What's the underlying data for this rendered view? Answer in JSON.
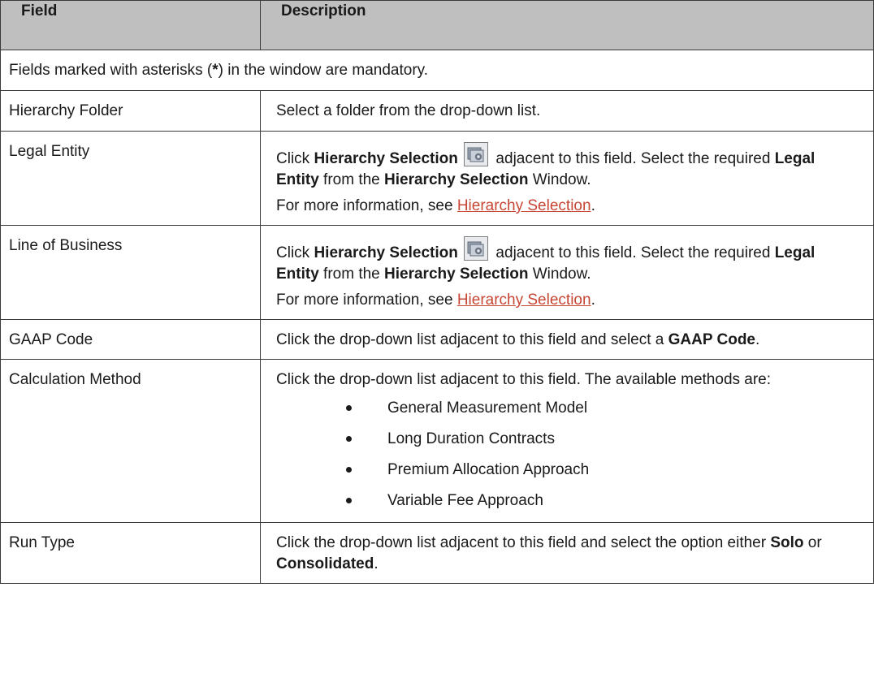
{
  "header": {
    "field": "Field",
    "description": "Description"
  },
  "note": {
    "before": "Fields marked with asterisks (",
    "star": "*",
    "after": ") in the window are mandatory."
  },
  "rows": [
    {
      "field": "Hierarchy Folder",
      "text": "Select a folder from the drop-down list."
    },
    {
      "field": "Legal Entity",
      "click": "Click ",
      "bold1": "Hierarchy Selection",
      "icon": "hierarchy-selection-icon",
      "t2": " adjacent to this field. Select the required ",
      "bold2": "Legal Entity",
      "t3": " from the ",
      "bold3": "Hierarchy Selection",
      "t4": " Window.",
      "more": "For more information, see ",
      "link": "Hierarchy Selection",
      "end": "."
    },
    {
      "field": "Line of Business",
      "click": "Click ",
      "bold1": "Hierarchy Selection",
      "icon": "hierarchy-selection-icon",
      "t2": " adjacent to this field. Select the required ",
      "bold2": "Legal Entity",
      "t3": " from the ",
      "bold3": "Hierarchy Selection",
      "t4": " Window.",
      "more": "For more information, see ",
      "link": "Hierarchy Selection",
      "end": "."
    },
    {
      "field": "GAAP Code",
      "t1": "Click the drop-down list adjacent to this field and select a ",
      "bold1": "GAAP Code",
      "end": "."
    },
    {
      "field": "Calculation Method",
      "t1": "Click the drop-down list adjacent to this field. The available methods are:",
      "methods": [
        "General Measurement Model",
        "Long Duration Contracts",
        "Premium Allocation Approach",
        "Variable Fee Approach"
      ]
    },
    {
      "field": "Run Type",
      "t1": "Click the drop-down list adjacent to this field and select the option either ",
      "bold1": "Solo",
      "t2": " or ",
      "bold2": "Consolidated",
      "end": "."
    }
  ]
}
